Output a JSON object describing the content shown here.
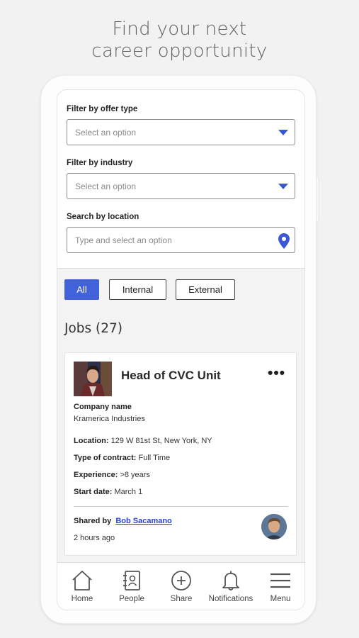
{
  "headline": {
    "line1": "Find your next",
    "line2": "career opportunity"
  },
  "filters": {
    "offer_type": {
      "label": "Filter by offer type",
      "placeholder": "Select an option"
    },
    "industry": {
      "label": "Filter by industry",
      "placeholder": "Select an option"
    },
    "location": {
      "label": "Search by location",
      "placeholder": "Type and select an option"
    }
  },
  "tabs": [
    {
      "label": "All",
      "selected": true
    },
    {
      "label": "Internal",
      "selected": false
    },
    {
      "label": "External",
      "selected": false
    }
  ],
  "jobs": {
    "title": "Jobs (27)",
    "card": {
      "title": "Head of CVC Unit",
      "more_label": "•••",
      "company_label": "Company name",
      "company": "Kramerica Industries",
      "location_label": "Location:",
      "location": "129 W 81st St, New York, NY",
      "contract_label": "Type of contract:",
      "contract": "Full Time",
      "experience_label": "Experience:",
      "experience": ">8 years",
      "start_label": "Start date:",
      "start": "March 1",
      "shared_label": "Shared by",
      "shared_by": "Bob Sacamano",
      "time": "2 hours ago"
    }
  },
  "nav": [
    {
      "label": "Home",
      "icon": "home-icon"
    },
    {
      "label": "People",
      "icon": "contacts-book-icon"
    },
    {
      "label": "Share",
      "icon": "plus-circle-icon"
    },
    {
      "label": "Notifications",
      "icon": "bell-icon"
    },
    {
      "label": "Menu",
      "icon": "hamburger-menu-icon"
    }
  ],
  "colors": {
    "accent": "#4262d9",
    "link": "#2a40d8",
    "caret": "#3a58d6"
  }
}
